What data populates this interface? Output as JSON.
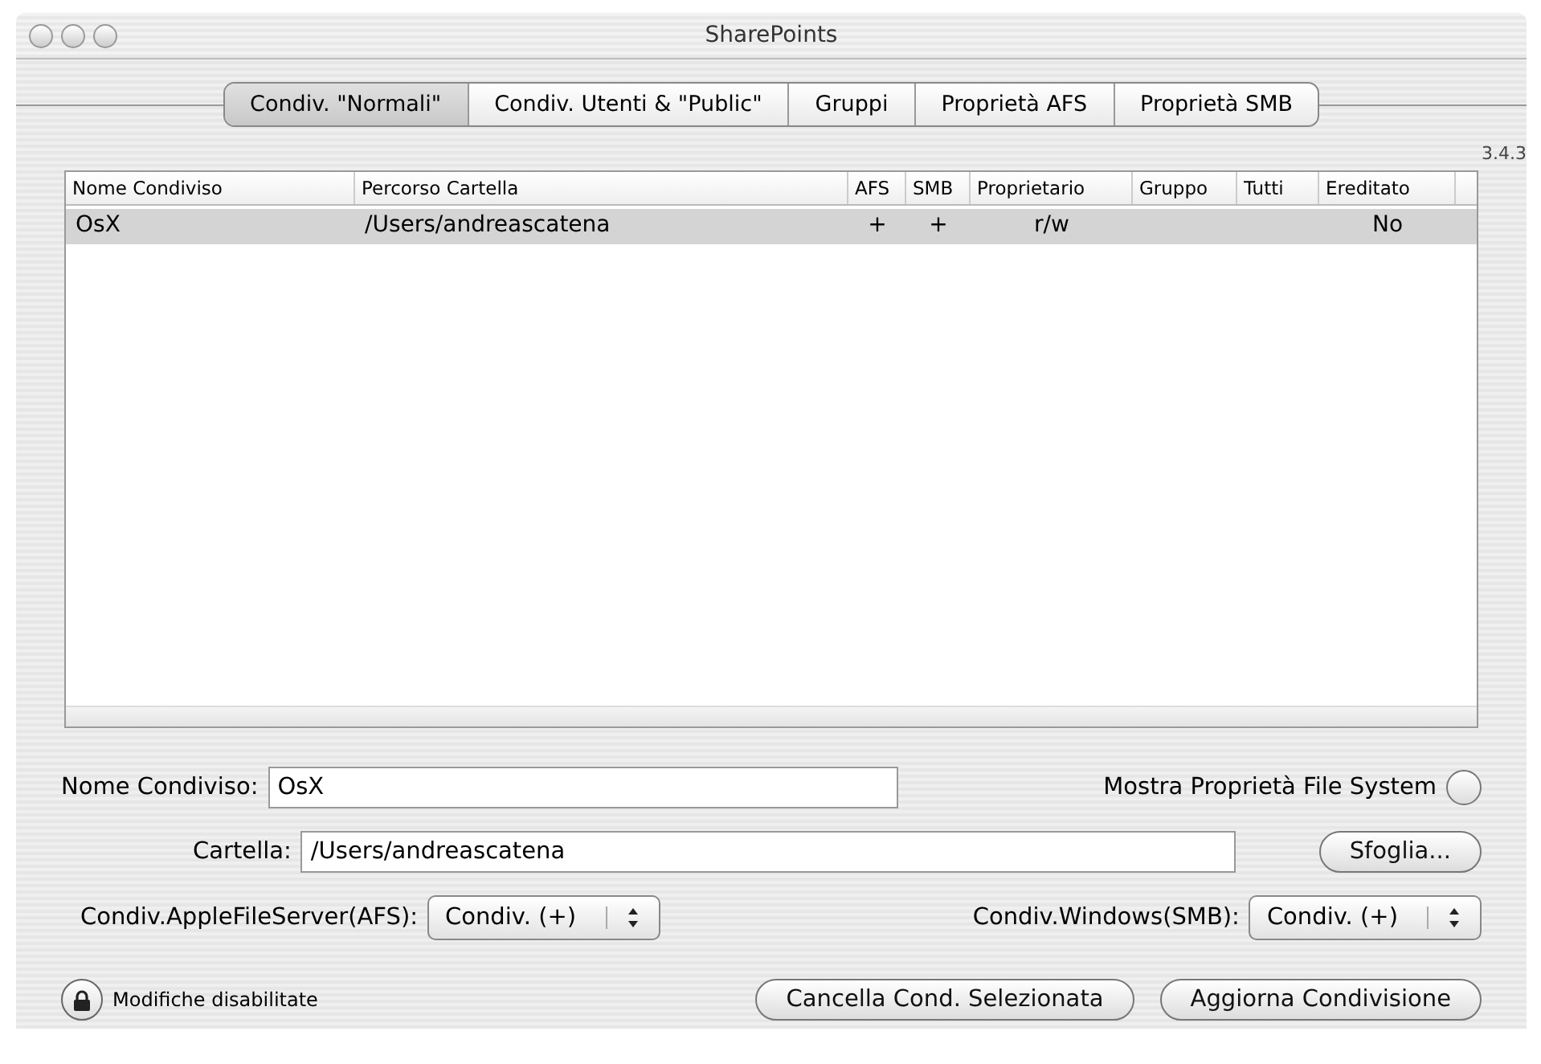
{
  "window": {
    "title": "SharePoints"
  },
  "tabs": [
    {
      "label": "Condiv. \"Normali\"",
      "selected": true
    },
    {
      "label": "Condiv. Utenti & \"Public\"",
      "selected": false
    },
    {
      "label": "Gruppi",
      "selected": false
    },
    {
      "label": "Proprietà AFS",
      "selected": false
    },
    {
      "label": "Proprietà SMB",
      "selected": false
    }
  ],
  "version": "3.4.3",
  "table": {
    "columns": [
      "Nome Condiviso",
      "Percorso Cartella",
      "AFS",
      "SMB",
      "Proprietario",
      "Gruppo",
      "Tutti",
      "Ereditato"
    ],
    "rows": [
      {
        "cells": [
          "OsX",
          "/Users/andreascatena",
          "+",
          "+",
          "r/w",
          "",
          "",
          "No"
        ],
        "selected": true
      }
    ]
  },
  "form": {
    "name_label": "Nome Condiviso:",
    "name_value": "OsX",
    "show_fs_label": "Mostra Proprietà File System",
    "show_fs_checked": false,
    "folder_label": "Cartella:",
    "folder_value": "/Users/andreascatena",
    "browse_button": "Sfoglia...",
    "afs_label": "Condiv.AppleFileServer(AFS):",
    "afs_value": "Condiv. (+)",
    "smb_label": "Condiv.Windows(SMB):",
    "smb_value": "Condiv. (+)"
  },
  "lock": {
    "label": "Modifiche disabilitate",
    "locked": true
  },
  "buttons": [
    "Cancella Cond. Selezionata",
    "Aggiorna Condivisione"
  ]
}
